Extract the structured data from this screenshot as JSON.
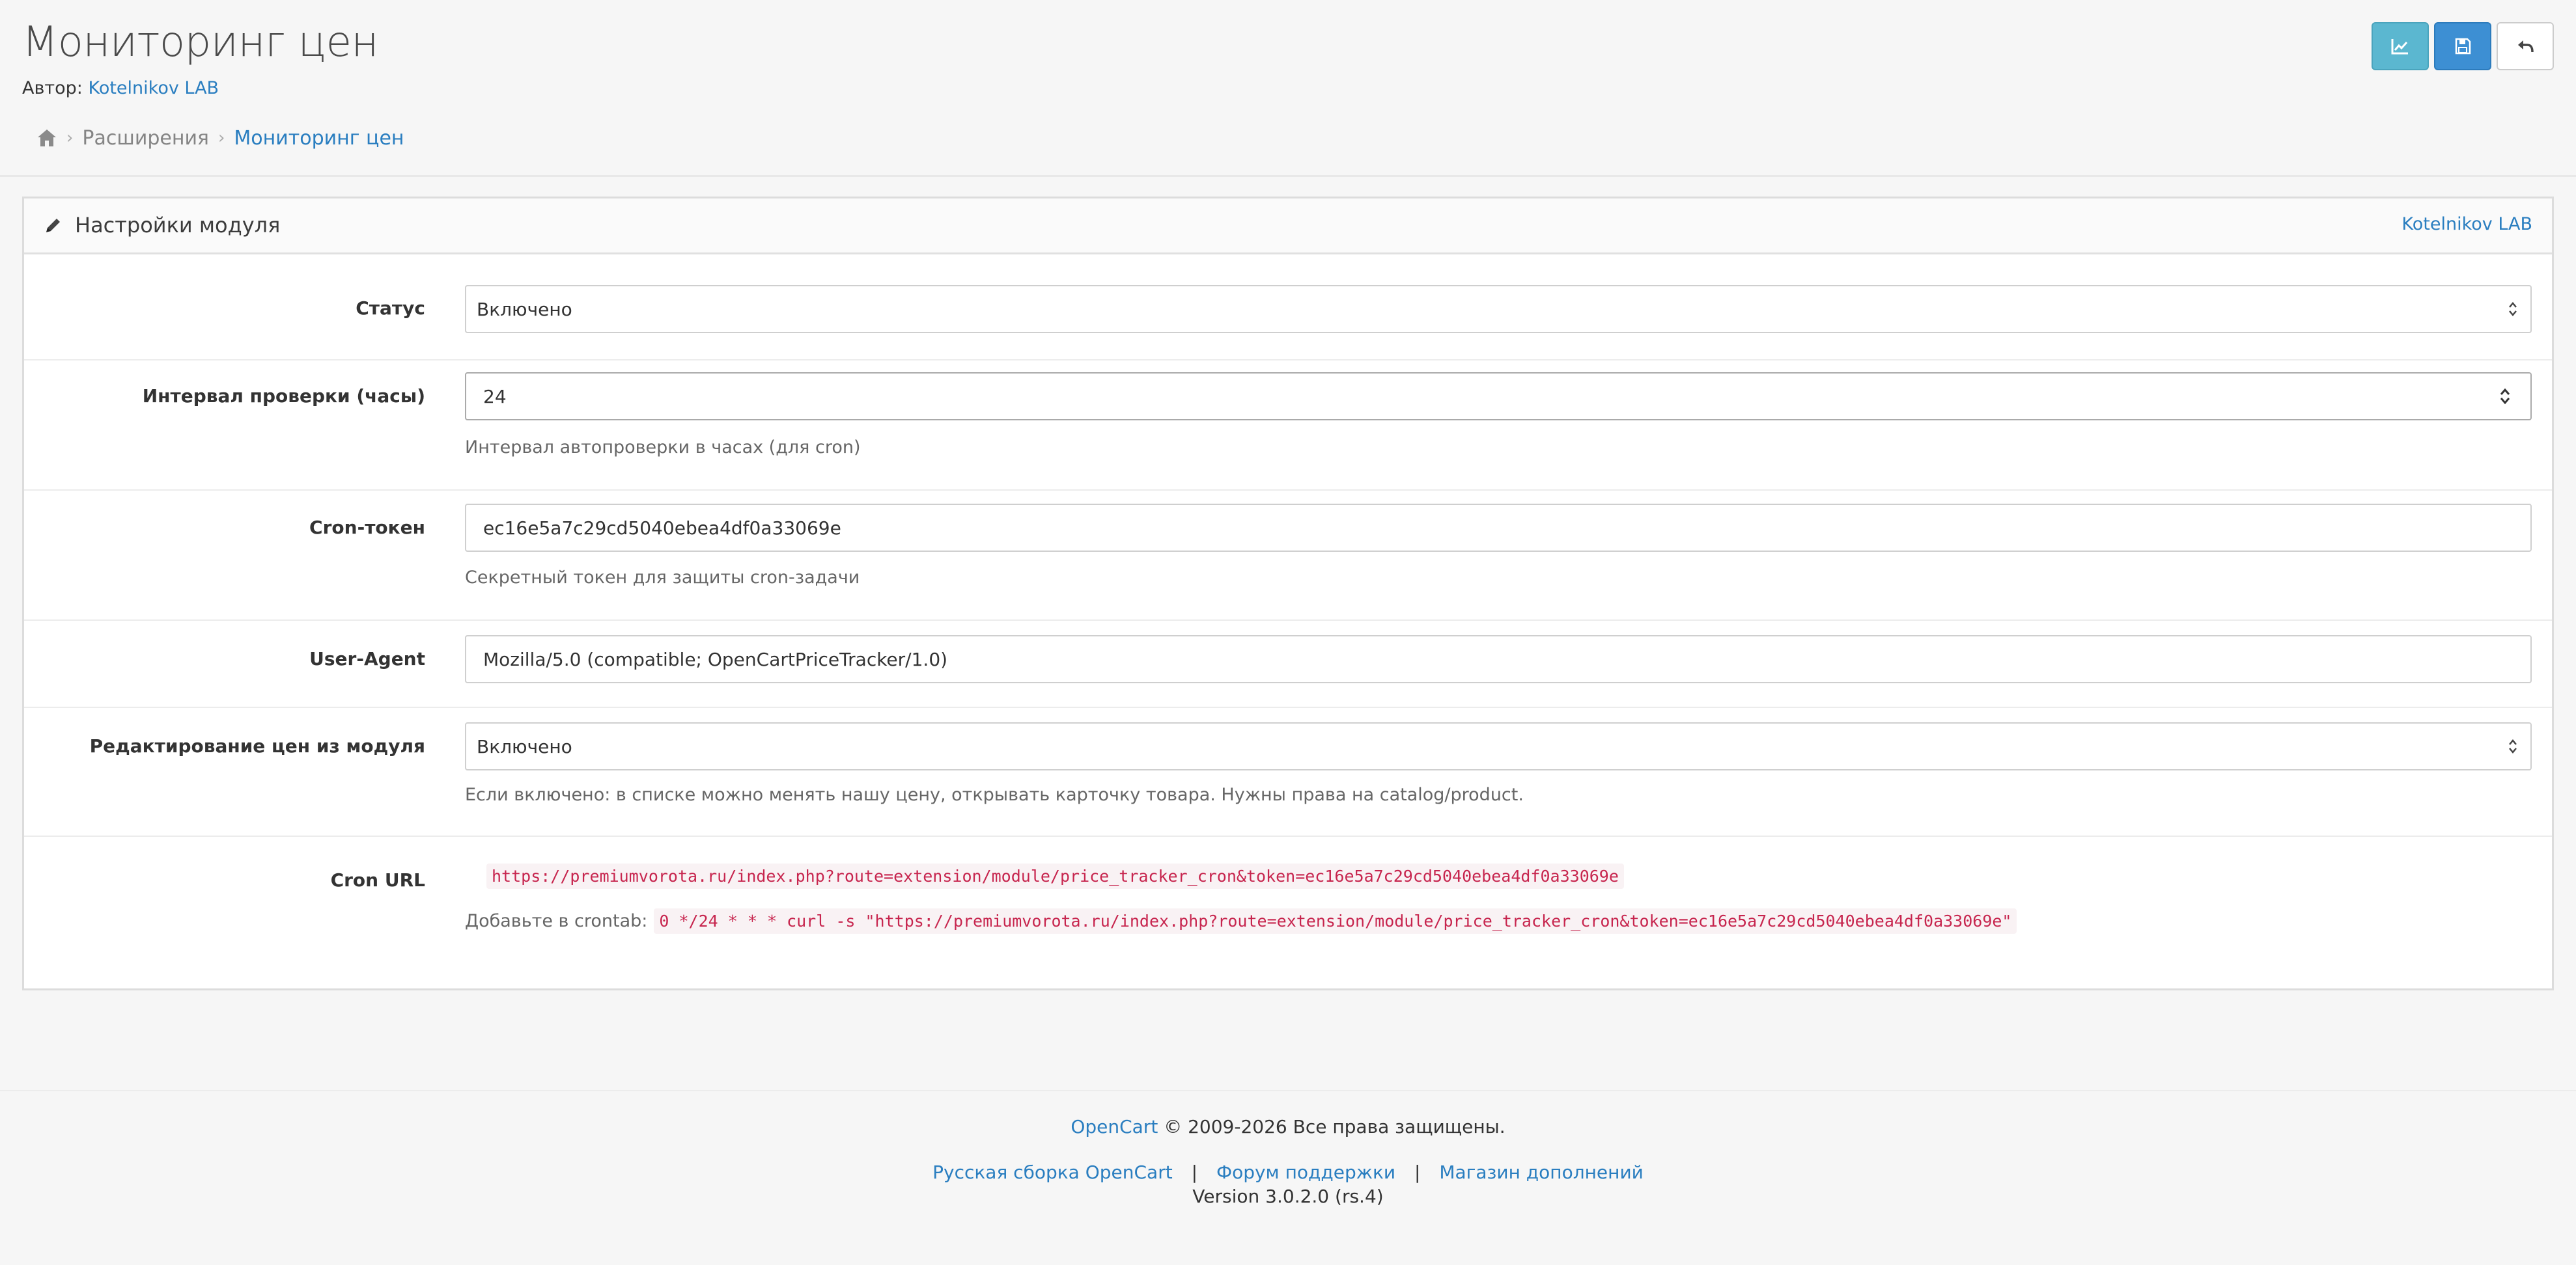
{
  "header": {
    "title": "Мониторинг цен",
    "author_label": "Автор:",
    "author_name": "Kotelnikov LAB",
    "breadcrumb": {
      "home_icon": "home-icon",
      "items": [
        "Расширения",
        "Мониторинг цен"
      ]
    },
    "buttons": [
      {
        "icon": "line-chart-icon",
        "color": "#5bb7d0"
      },
      {
        "icon": "save-icon",
        "color": "#3d8fd3"
      },
      {
        "icon": "back-arrow-icon",
        "color": "#ffffff"
      }
    ]
  },
  "panel": {
    "title_icon": "pencil-icon",
    "title": "Настройки модуля",
    "right_link": "Kotelnikov LAB",
    "fields": {
      "status": {
        "label": "Статус",
        "value": "Включено"
      },
      "interval": {
        "label": "Интервал проверки (часы)",
        "value": "24",
        "help": "Интервал автопроверки в часах (для cron)"
      },
      "token": {
        "label": "Cron-токен",
        "value": "ec16e5a7c29cd5040ebea4df0a33069e",
        "help": "Секретный токен для защиты cron-задачи"
      },
      "user_agent": {
        "label": "User-Agent",
        "value": "Mozilla/5.0 (compatible; OpenCartPriceTracker/1.0)"
      },
      "edit_prices": {
        "label": "Редактирование цен из модуля",
        "value": "Включено",
        "help": "Если включено: в списке можно менять нашу цену, открывать карточку товара. Нужны права на catalog/product."
      },
      "cron_url": {
        "label": "Cron URL",
        "url": "https://premiumvorota.ru/index.php?route=extension/module/price_tracker_cron&token=ec16e5a7c29cd5040ebea4df0a33069e",
        "crontab_label": "Добавьте в crontab:",
        "crontab_cmd": "0 */24 * * * curl -s \"https://premiumvorota.ru/index.php?route=extension/module/price_tracker_cron&token=ec16e5a7c29cd5040ebea4df0a33069e\""
      }
    }
  },
  "footer": {
    "opencart_link": "OpenCart",
    "copyright": "© 2009-2026 Все права защищены.",
    "links": [
      "Русская сборка OpenCart",
      "Форум поддержки",
      "Магазин дополнений"
    ],
    "separator": "|",
    "version": "Version 3.0.2.0 (rs.4)"
  },
  "colors": {
    "link": "#2a7ec0",
    "code_text": "#c7254e",
    "code_bg": "#f9f2f4"
  }
}
